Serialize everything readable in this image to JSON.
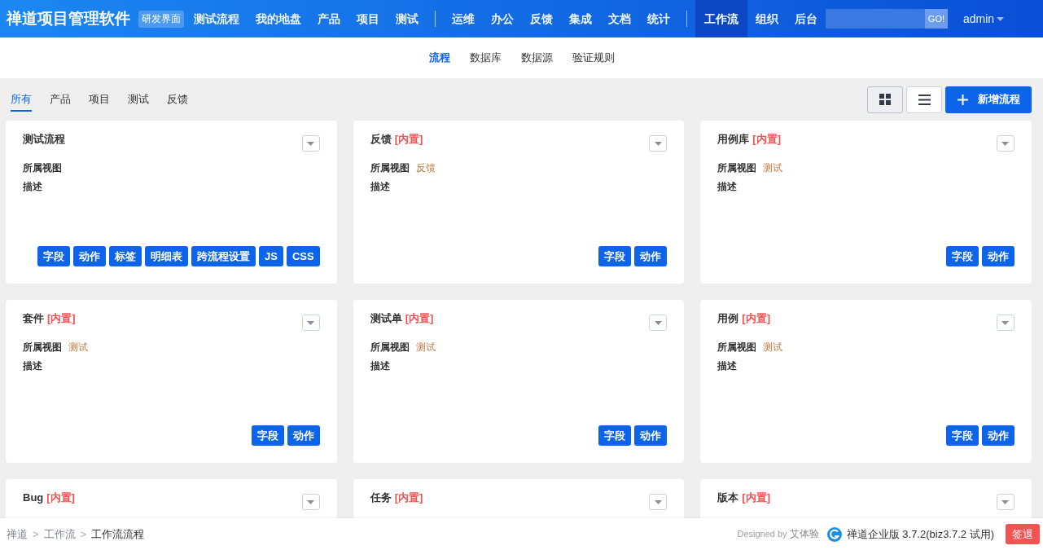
{
  "header": {
    "brand": "禅道项目管理软件",
    "badge": "研发界面",
    "nav": [
      {
        "kind": "item",
        "label": "测试流程",
        "selected": false
      },
      {
        "kind": "item",
        "label": "我的地盘",
        "selected": false
      },
      {
        "kind": "item",
        "label": "产品",
        "selected": false
      },
      {
        "kind": "item",
        "label": "项目",
        "selected": false
      },
      {
        "kind": "item",
        "label": "测试",
        "selected": false
      },
      {
        "kind": "divider"
      },
      {
        "kind": "item",
        "label": "运维",
        "selected": false
      },
      {
        "kind": "item",
        "label": "办公",
        "selected": false
      },
      {
        "kind": "item",
        "label": "反馈",
        "selected": false
      },
      {
        "kind": "item",
        "label": "集成",
        "selected": false
      },
      {
        "kind": "item",
        "label": "文档",
        "selected": false
      },
      {
        "kind": "item",
        "label": "统计",
        "selected": false
      },
      {
        "kind": "divider"
      },
      {
        "kind": "item",
        "label": "工作流",
        "selected": true
      },
      {
        "kind": "item",
        "label": "组织",
        "selected": false
      },
      {
        "kind": "item",
        "label": "后台",
        "selected": false
      }
    ],
    "search_button": "GO!",
    "user": "admin"
  },
  "subnav": [
    {
      "label": "流程",
      "selected": true
    },
    {
      "label": "数据库",
      "selected": false
    },
    {
      "label": "数据源",
      "selected": false
    },
    {
      "label": "验证规则",
      "selected": false
    }
  ],
  "filters": [
    {
      "label": "所有",
      "selected": true
    },
    {
      "label": "产品",
      "selected": false
    },
    {
      "label": "项目",
      "selected": false
    },
    {
      "label": "测试",
      "selected": false
    },
    {
      "label": "反馈",
      "selected": false
    }
  ],
  "view_toggles": [
    {
      "kind": "grid",
      "selected": true
    },
    {
      "kind": "list",
      "selected": false
    }
  ],
  "add_button": "新增流程",
  "cards": [
    {
      "title": "测试流程",
      "view_label": "所属视图",
      "desc_label": "描述",
      "actions": [
        "字段",
        "动作",
        "标签",
        "明细表",
        "跨流程设置",
        "JS",
        "CSS"
      ]
    },
    {
      "title": "反馈",
      "built_in": "[内置]",
      "view_label": "所属视图",
      "view": "反馈",
      "desc_label": "描述",
      "actions": [
        "字段",
        "动作"
      ]
    },
    {
      "title": "用例库",
      "built_in": "[内置]",
      "view_label": "所属视图",
      "view": "测试",
      "desc_label": "描述",
      "actions": [
        "字段",
        "动作"
      ]
    },
    {
      "title": "套件",
      "built_in": "[内置]",
      "view_label": "所属视图",
      "view": "测试",
      "desc_label": "描述",
      "actions": [
        "字段",
        "动作"
      ]
    },
    {
      "title": "测试单",
      "built_in": "[内置]",
      "view_label": "所属视图",
      "view": "测试",
      "desc_label": "描述",
      "actions": [
        "字段",
        "动作"
      ]
    },
    {
      "title": "用例",
      "built_in": "[内置]",
      "view_label": "所属视图",
      "view": "测试",
      "desc_label": "描述",
      "actions": [
        "字段",
        "动作"
      ]
    },
    {
      "title": "Bug",
      "built_in": "[内置]"
    },
    {
      "title": "任务",
      "built_in": "[内置]"
    },
    {
      "title": "版本",
      "built_in": "[内置]"
    }
  ],
  "footer": {
    "breadcrumb": [
      {
        "label": "禅道",
        "current": false
      },
      {
        "label": ">",
        "kind": "sep"
      },
      {
        "label": "工作流",
        "current": false
      },
      {
        "label": ">",
        "kind": "sep"
      },
      {
        "label": "工作流流程",
        "current": true
      }
    ],
    "designed_by": "Designed by",
    "designer": "艾体验",
    "version": "禅道企业版 3.7.2(biz3.7.2 试用)",
    "logout": "签退"
  }
}
